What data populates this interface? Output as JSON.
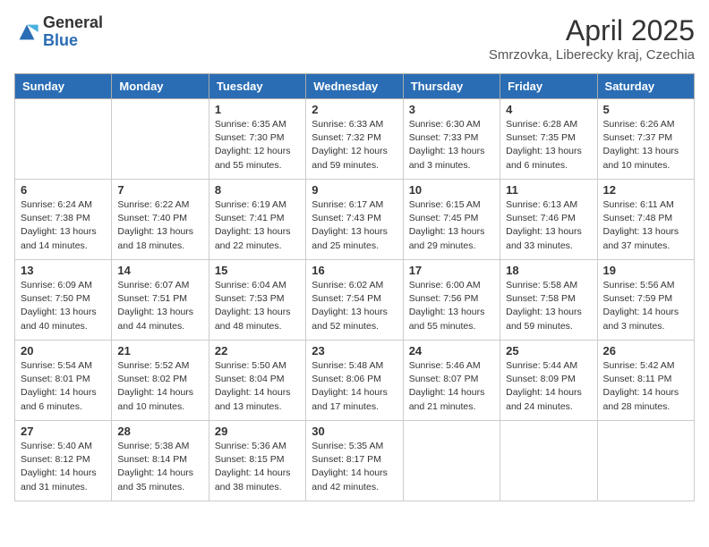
{
  "logo": {
    "general": "General",
    "blue": "Blue"
  },
  "title": "April 2025",
  "location": "Smrzovka, Liberecky kraj, Czechia",
  "weekdays": [
    "Sunday",
    "Monday",
    "Tuesday",
    "Wednesday",
    "Thursday",
    "Friday",
    "Saturday"
  ],
  "weeks": [
    [
      null,
      null,
      {
        "day": "1",
        "sunrise": "Sunrise: 6:35 AM",
        "sunset": "Sunset: 7:30 PM",
        "daylight": "Daylight: 12 hours and 55 minutes."
      },
      {
        "day": "2",
        "sunrise": "Sunrise: 6:33 AM",
        "sunset": "Sunset: 7:32 PM",
        "daylight": "Daylight: 12 hours and 59 minutes."
      },
      {
        "day": "3",
        "sunrise": "Sunrise: 6:30 AM",
        "sunset": "Sunset: 7:33 PM",
        "daylight": "Daylight: 13 hours and 3 minutes."
      },
      {
        "day": "4",
        "sunrise": "Sunrise: 6:28 AM",
        "sunset": "Sunset: 7:35 PM",
        "daylight": "Daylight: 13 hours and 6 minutes."
      },
      {
        "day": "5",
        "sunrise": "Sunrise: 6:26 AM",
        "sunset": "Sunset: 7:37 PM",
        "daylight": "Daylight: 13 hours and 10 minutes."
      }
    ],
    [
      {
        "day": "6",
        "sunrise": "Sunrise: 6:24 AM",
        "sunset": "Sunset: 7:38 PM",
        "daylight": "Daylight: 13 hours and 14 minutes."
      },
      {
        "day": "7",
        "sunrise": "Sunrise: 6:22 AM",
        "sunset": "Sunset: 7:40 PM",
        "daylight": "Daylight: 13 hours and 18 minutes."
      },
      {
        "day": "8",
        "sunrise": "Sunrise: 6:19 AM",
        "sunset": "Sunset: 7:41 PM",
        "daylight": "Daylight: 13 hours and 22 minutes."
      },
      {
        "day": "9",
        "sunrise": "Sunrise: 6:17 AM",
        "sunset": "Sunset: 7:43 PM",
        "daylight": "Daylight: 13 hours and 25 minutes."
      },
      {
        "day": "10",
        "sunrise": "Sunrise: 6:15 AM",
        "sunset": "Sunset: 7:45 PM",
        "daylight": "Daylight: 13 hours and 29 minutes."
      },
      {
        "day": "11",
        "sunrise": "Sunrise: 6:13 AM",
        "sunset": "Sunset: 7:46 PM",
        "daylight": "Daylight: 13 hours and 33 minutes."
      },
      {
        "day": "12",
        "sunrise": "Sunrise: 6:11 AM",
        "sunset": "Sunset: 7:48 PM",
        "daylight": "Daylight: 13 hours and 37 minutes."
      }
    ],
    [
      {
        "day": "13",
        "sunrise": "Sunrise: 6:09 AM",
        "sunset": "Sunset: 7:50 PM",
        "daylight": "Daylight: 13 hours and 40 minutes."
      },
      {
        "day": "14",
        "sunrise": "Sunrise: 6:07 AM",
        "sunset": "Sunset: 7:51 PM",
        "daylight": "Daylight: 13 hours and 44 minutes."
      },
      {
        "day": "15",
        "sunrise": "Sunrise: 6:04 AM",
        "sunset": "Sunset: 7:53 PM",
        "daylight": "Daylight: 13 hours and 48 minutes."
      },
      {
        "day": "16",
        "sunrise": "Sunrise: 6:02 AM",
        "sunset": "Sunset: 7:54 PM",
        "daylight": "Daylight: 13 hours and 52 minutes."
      },
      {
        "day": "17",
        "sunrise": "Sunrise: 6:00 AM",
        "sunset": "Sunset: 7:56 PM",
        "daylight": "Daylight: 13 hours and 55 minutes."
      },
      {
        "day": "18",
        "sunrise": "Sunrise: 5:58 AM",
        "sunset": "Sunset: 7:58 PM",
        "daylight": "Daylight: 13 hours and 59 minutes."
      },
      {
        "day": "19",
        "sunrise": "Sunrise: 5:56 AM",
        "sunset": "Sunset: 7:59 PM",
        "daylight": "Daylight: 14 hours and 3 minutes."
      }
    ],
    [
      {
        "day": "20",
        "sunrise": "Sunrise: 5:54 AM",
        "sunset": "Sunset: 8:01 PM",
        "daylight": "Daylight: 14 hours and 6 minutes."
      },
      {
        "day": "21",
        "sunrise": "Sunrise: 5:52 AM",
        "sunset": "Sunset: 8:02 PM",
        "daylight": "Daylight: 14 hours and 10 minutes."
      },
      {
        "day": "22",
        "sunrise": "Sunrise: 5:50 AM",
        "sunset": "Sunset: 8:04 PM",
        "daylight": "Daylight: 14 hours and 13 minutes."
      },
      {
        "day": "23",
        "sunrise": "Sunrise: 5:48 AM",
        "sunset": "Sunset: 8:06 PM",
        "daylight": "Daylight: 14 hours and 17 minutes."
      },
      {
        "day": "24",
        "sunrise": "Sunrise: 5:46 AM",
        "sunset": "Sunset: 8:07 PM",
        "daylight": "Daylight: 14 hours and 21 minutes."
      },
      {
        "day": "25",
        "sunrise": "Sunrise: 5:44 AM",
        "sunset": "Sunset: 8:09 PM",
        "daylight": "Daylight: 14 hours and 24 minutes."
      },
      {
        "day": "26",
        "sunrise": "Sunrise: 5:42 AM",
        "sunset": "Sunset: 8:11 PM",
        "daylight": "Daylight: 14 hours and 28 minutes."
      }
    ],
    [
      {
        "day": "27",
        "sunrise": "Sunrise: 5:40 AM",
        "sunset": "Sunset: 8:12 PM",
        "daylight": "Daylight: 14 hours and 31 minutes."
      },
      {
        "day": "28",
        "sunrise": "Sunrise: 5:38 AM",
        "sunset": "Sunset: 8:14 PM",
        "daylight": "Daylight: 14 hours and 35 minutes."
      },
      {
        "day": "29",
        "sunrise": "Sunrise: 5:36 AM",
        "sunset": "Sunset: 8:15 PM",
        "daylight": "Daylight: 14 hours and 38 minutes."
      },
      {
        "day": "30",
        "sunrise": "Sunrise: 5:35 AM",
        "sunset": "Sunset: 8:17 PM",
        "daylight": "Daylight: 14 hours and 42 minutes."
      },
      null,
      null,
      null
    ]
  ]
}
